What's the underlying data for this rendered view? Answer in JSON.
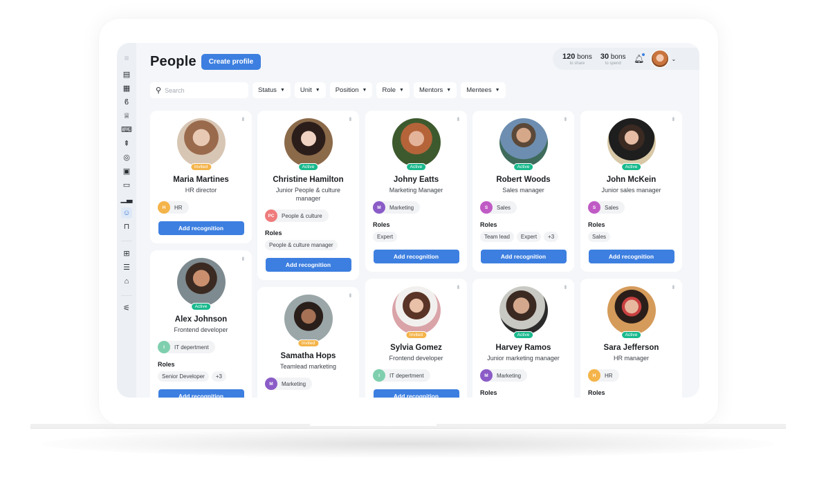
{
  "header": {
    "title": "People",
    "create_button": "Create profile",
    "bons_share_value": "120",
    "bons_share_unit": "bons",
    "bons_share_label": "to share",
    "bons_spend_value": "30",
    "bons_spend_unit": "bons",
    "bons_spend_label": "to spend"
  },
  "sidebar": {
    "icons": [
      "menu-icon",
      "feed-icon",
      "dashboard-icon",
      "bons-icon",
      "trophy-icon",
      "chat-user-icon",
      "rocket-icon",
      "target-icon",
      "feedback-icon",
      "calendar-icon",
      "chart-icon",
      "people-icon",
      "shopping-bag-icon",
      "org-chart-icon",
      "report-icon",
      "store-icon",
      "settings-sliders-icon"
    ],
    "active": "people-icon"
  },
  "search": {
    "placeholder": "Search",
    "value": ""
  },
  "filters": [
    "Status",
    "Unit",
    "Position",
    "Role",
    "Mentors",
    "Mentees"
  ],
  "common": {
    "roles_label": "Roles",
    "add_recognition": "Add recognition"
  },
  "colors": {
    "accent": "#3d7fe0",
    "active": "#19b98d",
    "invited": "#f4b44a",
    "dept_hr": "#f4b44a",
    "dept_pc": "#ef7b7b",
    "dept_marketing": "#8b5cc7",
    "dept_sales": "#c05bc5",
    "dept_it": "#7fcfae"
  },
  "people": [
    {
      "name": "Maria Martines",
      "position": "HR director",
      "status": "Invited",
      "dept_initials": "H",
      "dept": "HR",
      "roles": []
    },
    {
      "name": "Alex Johnson",
      "position": "Frontend developer",
      "status": "Active",
      "dept_initials": "I",
      "dept": "IT depertment",
      "roles": [
        "Senior Developer",
        "+3"
      ]
    },
    {
      "name": "Christine Hamilton",
      "position": "Junior People & culture manager",
      "status": "Active",
      "dept_initials": "PC",
      "dept": "People & culture",
      "roles": [
        "People & culture manager"
      ]
    },
    {
      "name": "Samatha Hops",
      "position": "Teamlead marketing",
      "status": "Invited",
      "dept_initials": "M",
      "dept": "Marketing",
      "roles": []
    },
    {
      "name": "Johny Eatts",
      "position": "Marketing Manager",
      "status": "Active",
      "dept_initials": "M",
      "dept": "Marketing",
      "roles": [
        "Expert"
      ]
    },
    {
      "name": "Sylvia Gomez",
      "position": "Frontend developer",
      "status": "Invited",
      "dept_initials": "I",
      "dept": "IT depertment",
      "roles": []
    },
    {
      "name": "Robert Woods",
      "position": "Sales manager",
      "status": "Active",
      "dept_initials": "S",
      "dept": "Sales",
      "roles": [
        "Team lead",
        "Expert",
        "+3"
      ]
    },
    {
      "name": "Harvey Ramos",
      "position": "Junior marketing manager",
      "status": "Active",
      "dept_initials": "M",
      "dept": "Marketing",
      "roles": []
    },
    {
      "name": "John McKein",
      "position": "Junior sales manager",
      "status": "Active",
      "dept_initials": "S",
      "dept": "Sales",
      "roles": [
        "Sales"
      ]
    },
    {
      "name": "Sara Jefferson",
      "position": "HR manager",
      "status": "Active",
      "dept_initials": "H",
      "dept": "HR",
      "roles": []
    }
  ]
}
